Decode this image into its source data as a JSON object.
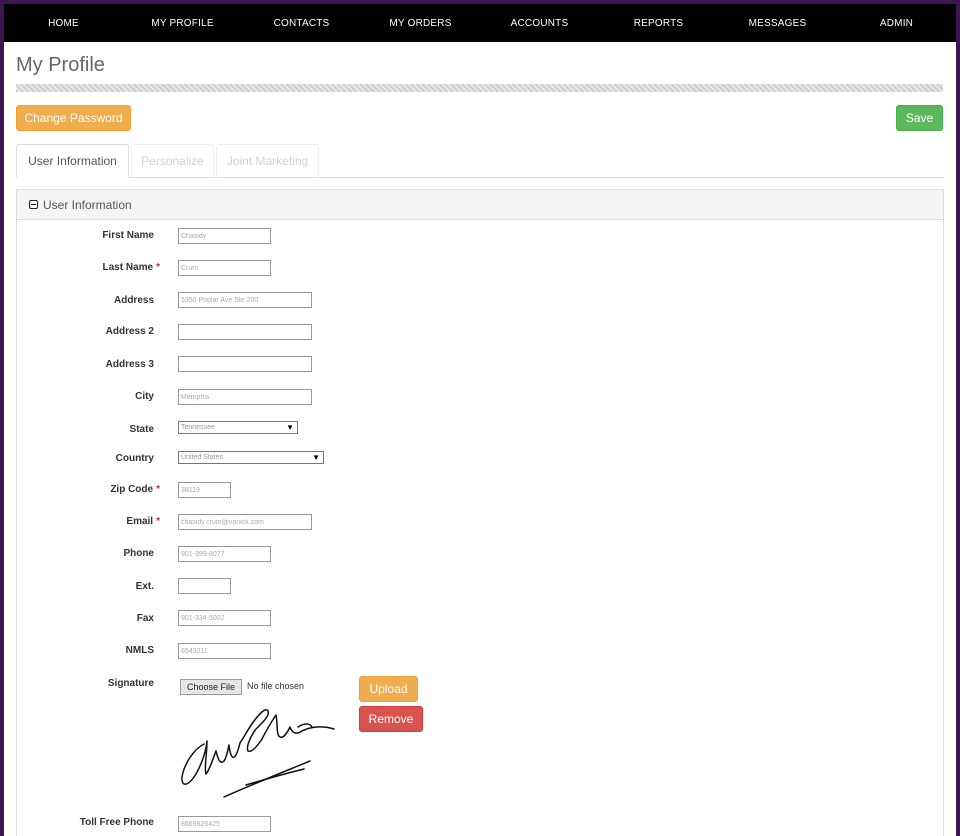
{
  "nav": [
    "HOME",
    "MY PROFILE",
    "CONTACTS",
    "MY ORDERS",
    "ACCOUNTS",
    "REPORTS",
    "MESSAGES",
    "ADMIN"
  ],
  "page_title": "My Profile",
  "buttons": {
    "change_password": "Change Password",
    "save": "Save",
    "upload": "Upload",
    "remove": "Remove"
  },
  "tabs": [
    "User Information",
    "Personalize",
    "Joint Marketing"
  ],
  "panel_title": "User Information",
  "fields": {
    "first_name": {
      "label": "First Name",
      "value": "Chasidy"
    },
    "last_name": {
      "label": "Last Name",
      "value": "Crum",
      "required": "*"
    },
    "address": {
      "label": "Address",
      "value": "5350 Poplar Ave Ste 200"
    },
    "address2": {
      "label": "Address 2",
      "value": ""
    },
    "address3": {
      "label": "Address 3",
      "value": ""
    },
    "city": {
      "label": "City",
      "value": "Memphis"
    },
    "state": {
      "label": "State",
      "value": "Tennessee"
    },
    "country": {
      "label": "Country",
      "value": "United States"
    },
    "zip": {
      "label": "Zip Code",
      "value": "38119",
      "required": "*"
    },
    "email": {
      "label": "Email",
      "value": "chasidy.crum@vanick.com",
      "required": "*"
    },
    "phone": {
      "label": "Phone",
      "value": "901-399-8077"
    },
    "ext": {
      "label": "Ext.",
      "value": ""
    },
    "fax": {
      "label": "Fax",
      "value": "901-334-5002"
    },
    "nmls": {
      "label": "NMLS",
      "value": "6543211"
    },
    "signature": {
      "label": "Signature",
      "choose_file": "Choose File",
      "no_file": "No file chosen"
    },
    "toll_free": {
      "label": "Toll Free Phone",
      "value": "8669826425"
    }
  },
  "colors": {
    "nav_bg": "#000000",
    "orange": "#f0ad4e",
    "green": "#5cb85c",
    "red": "#d9534f",
    "frame": "#3b1650"
  }
}
